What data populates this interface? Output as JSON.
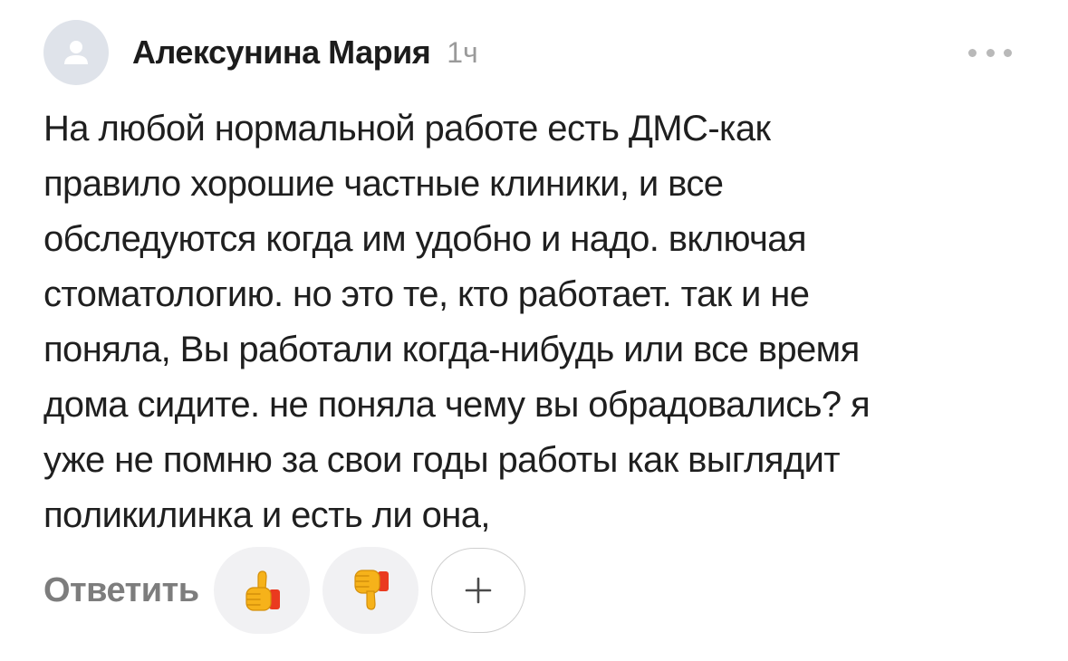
{
  "comment": {
    "author": "Алексунина Мария",
    "time": "1ч",
    "text_lines": [
      "На любой нормальной работе есть ДМС-как",
      "правило хорошие частные клиники, и все",
      "обследуются когда им удобно и надо. включая",
      "стоматологию. но это те, кто работает. так и не",
      "поняла, Вы работали когда-нибудь или все время",
      "дома сидите. не поняла чему вы обрадовались? я",
      "уже не помню за свои годы работы как выглядит",
      "поликилинка и есть ли она,"
    ]
  },
  "actions": {
    "reply_label": "Ответить",
    "like_icon": "thumbs-up-icon",
    "dislike_icon": "thumbs-down-icon",
    "add_icon": "plus-icon"
  },
  "icons": {
    "avatar": "user-silhouette-icon",
    "more": "more-dots-icon"
  },
  "colors": {
    "avatar_bg": "#dfe3ea",
    "time": "#9a9a9a",
    "reply": "#7d7d7d",
    "reaction_bg": "#f1f1f3",
    "emoji_yellow": "#f6b21a",
    "emoji_red": "#ea3a1f"
  }
}
